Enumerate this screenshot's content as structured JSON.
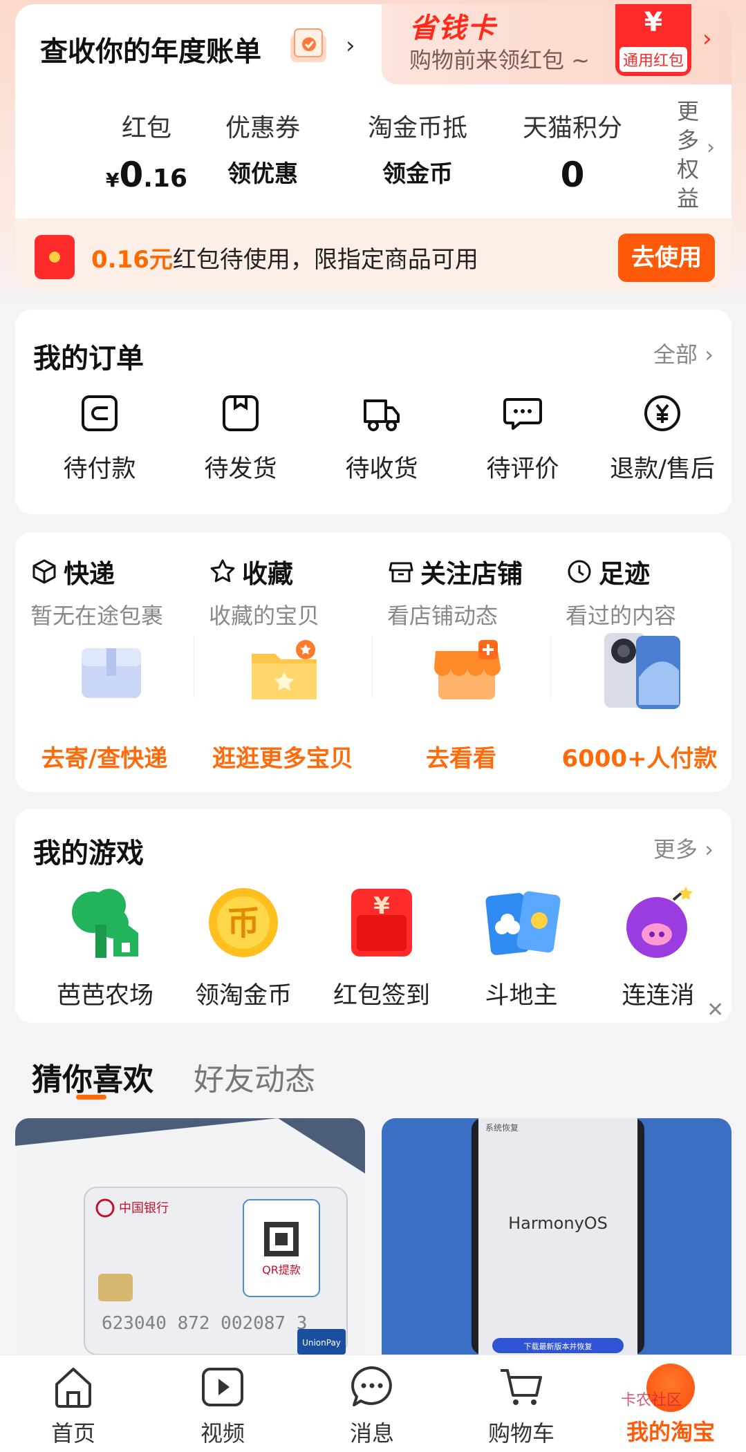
{
  "header": {
    "annual_bill": "查收你的年度账单",
    "promo_title": "省钱卡",
    "promo_subtitle": "购物前来领红包 ~",
    "promo_badge_symbol": "¥",
    "promo_badge_label": "通用红包"
  },
  "assets": [
    {
      "label": "红包",
      "yen": "¥",
      "int": "0",
      "dec": ".16"
    },
    {
      "label": "优惠券",
      "value": "领优惠"
    },
    {
      "label": "淘金币抵",
      "value": "领金币"
    },
    {
      "label": "天猫积分",
      "value": "0"
    }
  ],
  "more_rights": [
    "更",
    "多",
    "权",
    "益"
  ],
  "redpack_bar": {
    "amount": "0.16元",
    "text": "红包待使用，限指定商品可用",
    "button": "去使用"
  },
  "orders": {
    "title": "我的订单",
    "more": "全部",
    "items": [
      {
        "label": "待付款",
        "icon": "wallet-icon"
      },
      {
        "label": "待发货",
        "icon": "package-icon"
      },
      {
        "label": "待收货",
        "icon": "truck-icon"
      },
      {
        "label": "待评价",
        "icon": "comment-icon"
      },
      {
        "label": "退款/售后",
        "icon": "refund-icon"
      }
    ]
  },
  "quick": [
    {
      "title": "快递",
      "sub": "暂无在途包裹",
      "cta": "去寄/查快递",
      "icon": "box-icon"
    },
    {
      "title": "收藏",
      "sub": "收藏的宝贝",
      "cta": "逛逛更多宝贝",
      "icon": "star-icon"
    },
    {
      "title": "关注店铺",
      "sub": "看店铺动态",
      "cta": "去看看",
      "icon": "store-icon"
    },
    {
      "title": "足迹",
      "sub": "看过的内容",
      "cta": "6000+人付款",
      "icon": "clock-icon"
    }
  ],
  "games": {
    "title": "我的游戏",
    "more": "更多",
    "items": [
      {
        "label": "芭芭农场",
        "icon": "farm-tree-icon"
      },
      {
        "label": "领淘金币",
        "icon": "gold-coin-icon"
      },
      {
        "label": "红包签到",
        "icon": "red-envelope-icon"
      },
      {
        "label": "斗地主",
        "icon": "poker-cards-icon"
      },
      {
        "label": "连连消",
        "icon": "bomb-pig-icon"
      }
    ]
  },
  "feed_tabs": [
    "猜你喜欢",
    "好友动态"
  ],
  "feed_cards": {
    "card1_bank": "中国银行",
    "card1_qr": "QR提款",
    "card1_number": "623040 872 002087 3",
    "card1_unionpay": "UnionPay",
    "card2_top": "系统恢复",
    "card2_os": "HarmonyOS",
    "card2_button": "下载最新版本并恢复"
  },
  "bottom_nav": [
    {
      "label": "首页",
      "icon": "home-icon"
    },
    {
      "label": "视频",
      "icon": "video-icon"
    },
    {
      "label": "消息",
      "icon": "message-icon"
    },
    {
      "label": "购物车",
      "icon": "cart-icon"
    },
    {
      "label": "我的淘宝",
      "icon": "my-taobao-icon",
      "active": true
    }
  ],
  "watermark": "卡农社区",
  "colors": {
    "accent": "#ff5a0a",
    "red": "#ff2a2a",
    "page_bg": "#f4f4f6"
  }
}
